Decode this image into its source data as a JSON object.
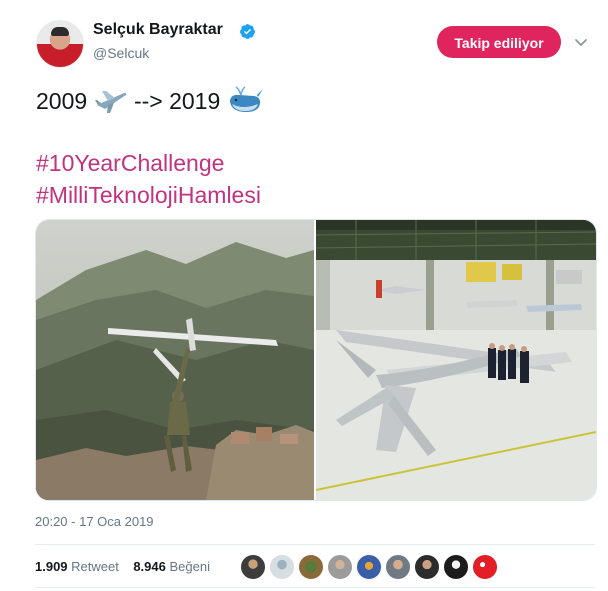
{
  "header": {
    "name": "Selçuk Bayraktar",
    "handle": "@Selcuk",
    "follow_label": "Takip ediliyor"
  },
  "tweet": {
    "line1_prefix": "2009",
    "line1_arrow": "-->",
    "line1_suffix": "2019",
    "hashtag1": "#10YearChallenge",
    "hashtag2": "#MilliTeknolojiHamlesi",
    "emoji_icons": [
      "airplane-emoji",
      "whale-emoji"
    ]
  },
  "media": {
    "photos": [
      "soldier-launching-mini-drone-photo",
      "large-drone-in-hangar-photo"
    ]
  },
  "meta": {
    "timestamp": "20:20 - 17 Oca 2019"
  },
  "stats": {
    "retweet_count": "1.909",
    "retweet_label": "Retweet",
    "like_count": "8.946",
    "like_label": "Beğeni"
  },
  "colors": {
    "accent": "#e0245e",
    "hashtag": "#c1337e",
    "verified": "#1da1f2",
    "muted": "#657786"
  }
}
